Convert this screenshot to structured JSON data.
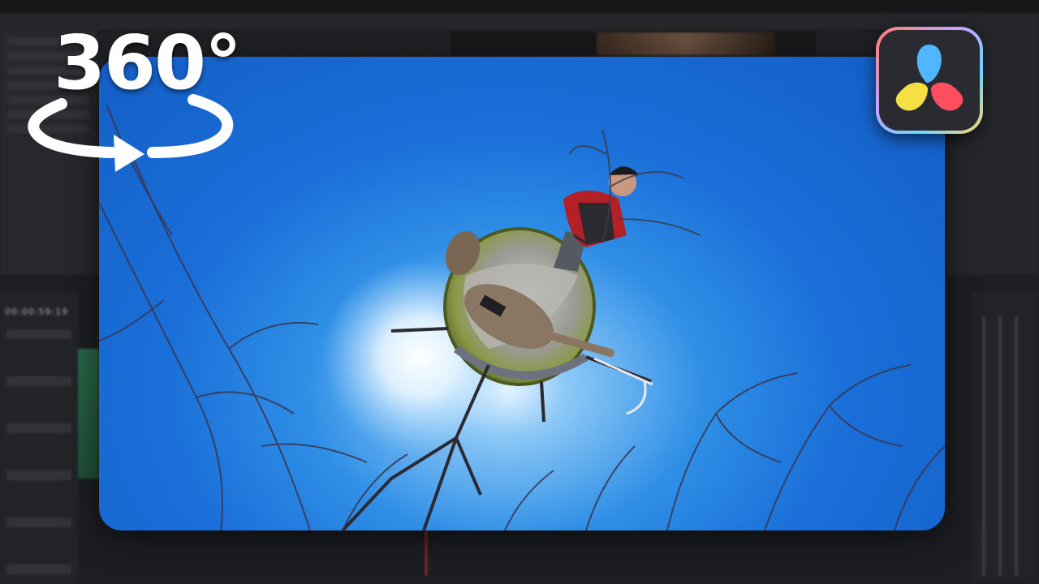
{
  "badge": {
    "text": "360°",
    "icon": "rotation-arrow-icon"
  },
  "app_logo": {
    "icon": "davinci-resolve-logo",
    "colors": [
      "#4fb6ff",
      "#f5e043",
      "#ff4f5e"
    ]
  },
  "background": {
    "timecode": "00:00:59:19"
  },
  "colors": {
    "sky": "#1a6fd8",
    "badge_text": "#ffffff",
    "logo_frame": "#2a2b31"
  }
}
